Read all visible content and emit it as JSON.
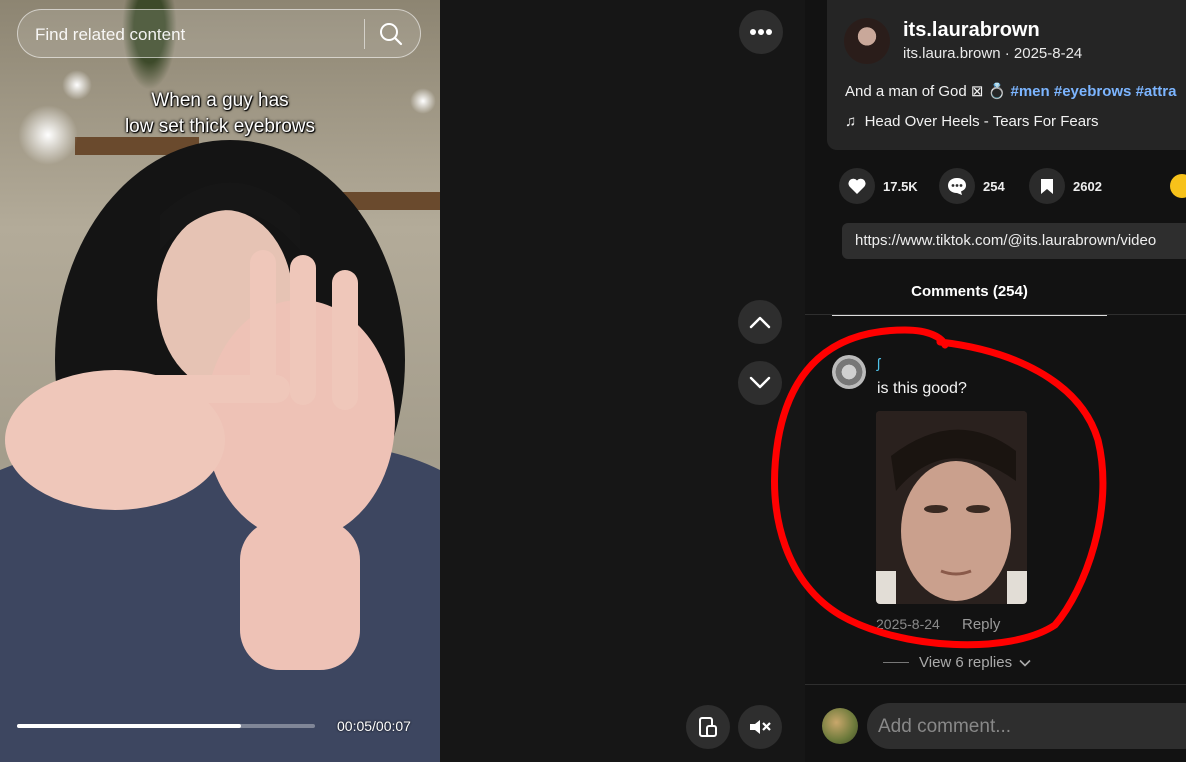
{
  "search": {
    "placeholder": "Find related content"
  },
  "video": {
    "caption_line1": "When a guy has",
    "caption_line2": "low set thick eyebrows",
    "time": "00:05/00:07",
    "progress": 0.75
  },
  "author": {
    "display_name": "its.laurabrown",
    "handle": "its.laura.brown",
    "date": "2025-8-24"
  },
  "description": {
    "text": "And a man of God ⊠ 💍",
    "hashtags": [
      "#men",
      "#eyebrows",
      "#attra"
    ]
  },
  "music": {
    "title": "Head Over Heels - Tears For Fears"
  },
  "stats": {
    "likes": "17.5K",
    "comments": "254",
    "saves": "2602"
  },
  "share_url": "https://www.tiktok.com/@its.laurabrown/video",
  "tabs": {
    "comments": "Comments (254)"
  },
  "comment": {
    "username": "ʃ",
    "text": "is this good?",
    "date": "2025-8-24",
    "reply": "Reply",
    "view_replies": "View 6 replies"
  },
  "comment_input": {
    "placeholder": "Add comment..."
  },
  "colors": {
    "annotation": "#ff0000",
    "hashtag": "#7cb5ff",
    "share_accent": "#f7c21a"
  }
}
